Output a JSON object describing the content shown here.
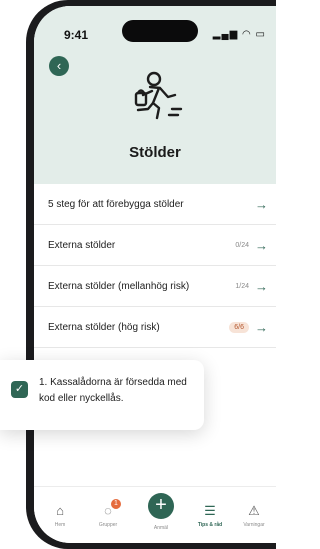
{
  "status_bar": {
    "time": "9:41",
    "icons": "▂▄▆ ◠ ▭"
  },
  "header": {
    "back_icon": "chevron-left-icon",
    "title": "Stölder",
    "illustration_icon": "running-thief-icon"
  },
  "list": {
    "items": [
      {
        "label": "5 steg för att förebygga stölder",
        "count": "",
        "badge": ""
      },
      {
        "label": "Externa stölder",
        "count": "0/24",
        "badge": ""
      },
      {
        "label": "Externa stölder (mellanhög risk)",
        "count": "1/24",
        "badge": ""
      },
      {
        "label": "Externa stölder (hög risk)",
        "count": "",
        "badge": "6/6"
      }
    ]
  },
  "toast": {
    "text": "1. Kassalådorna är försedda med kod eller nyckellås."
  },
  "tabbar": {
    "items": [
      {
        "label": "Hem",
        "icon": "home-icon"
      },
      {
        "label": "Grupper",
        "icon": "chat-icon",
        "badge": "1"
      },
      {
        "label": "Anmäl",
        "icon": "plus-icon"
      },
      {
        "label": "Tips & råd",
        "icon": "checklist-icon"
      },
      {
        "label": "Varningar",
        "icon": "warning-icon"
      }
    ]
  },
  "colors": {
    "accent": "#2f6655",
    "hero_bg": "#e3ede9",
    "badge": "#e56b3d"
  }
}
